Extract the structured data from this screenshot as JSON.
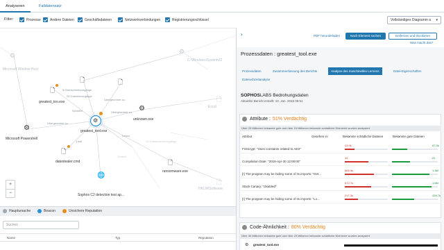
{
  "tabs": [
    "Analyseren",
    "Falldatensatz"
  ],
  "filter": {
    "label": "Filter:",
    "items": [
      "Prozesse",
      "Andere Dateien",
      "Geschäftsdateien",
      "Netzwerkverbindungen",
      "Registrierungsschlüssel"
    ],
    "dropdown": "Vollständiges Diagramm a",
    "dropdown_icon": "chevron-down-icon"
  },
  "graph": {
    "center": "greatest_tool.exe",
    "nodes": {
      "powershell": "Microsoft Powershell",
      "greatest_doc": "greatest_too.exe",
      "unknown": "unknown.exe",
      "datestealer": "datestealer.cmd",
      "ransomware": "ransomware.exe",
      "c2": "Sophos C2 detection test ap...",
      "faded_top_left": "Microsoft Window Host",
      "faded_top_right": "C:\\Windows\\System32",
      "faded_right": "Excel",
      "faded_right2": "HKLM\\Software"
    },
    "edges": {
      "e1": "5 Dateischreibvorgänge",
      "e2": "26 Dateieisvorgänge",
      "e3": "Übergeordnet zu",
      "e4": "Schreibt",
      "e5": "Übergeordnet zu",
      "e6": "Übergeordnet zu",
      "e7": "15 Dateischreibvorgänge",
      "e8": "Lädt",
      "e9": "Lesen",
      "e10": "Erstellt"
    },
    "zoom": [
      "+",
      "−"
    ]
  },
  "legend": [
    {
      "label": "Hauptursache",
      "color": "#a0a8b0"
    },
    {
      "label": "Beacon",
      "color": "#2a8fd8"
    },
    {
      "label": "Unsichere Reputation",
      "color": "#e88c1a"
    }
  ],
  "search": {
    "placeholder": "Suchen"
  },
  "table_headers": [
    "Name",
    "Typ",
    "Reputation"
  ],
  "right": {
    "buttons": {
      "pdf": "PDF herunterladen",
      "next": "Nach Element suchen",
      "remove": "Entfernen und blockieren",
      "what": "Was macht das?"
    },
    "title": "Prozessdaten : greatest_tool.exe",
    "subtabs": [
      "Prozessdaten",
      "Zusammenfassung des Berichts",
      "Analyse des maschinellen Lernens",
      "Datei-Eigenschaften",
      "Dateiuchzeitanalyse"
    ],
    "sophos_brand": "SOPHOS",
    "sophos_rest": "LABS Bedrohungsdaten",
    "report": "Aktueller Bericht erstellt: 10. Jan. 2019 09:51",
    "attr": {
      "title": "Attribute :",
      "verdict": "51% Verdächtig",
      "note": "Über 29 Millionen bekannte gute und über 15 Millionen bekannte schädliche Elemente wurden analysiert",
      "col_attr": "Attribut",
      "col_seen": "Gesehen in:",
      "col_bad": "Bekannte schädliche Dateien",
      "col_good": "Bekannte gute Dateien",
      "rows": [
        {
          "label": "Firstcrypt: \"Uses constants related to AES\"",
          "bad": "43.9k",
          "good": "67.3k",
          "bad_frac": 0.22,
          "good_frac": 0.34
        },
        {
          "label": "Compilation Date: \"2018-Apr-30 12:00:00\"",
          "bad": "34",
          "good": "22",
          "bad_frac": 0.55,
          "good_frac": 0.4
        },
        {
          "label": "[!] The program may be hiding some of its imports: \"Get...",
          "bad": "665.9k",
          "good": "1.3M",
          "bad_frac": 0.68,
          "good_frac": 0.82
        },
        {
          "label": "Stack Canary: \"disabled\"",
          "bad": "672.7k",
          "good": "1.6M",
          "bad_frac": 0.62,
          "good_frac": 0.86
        },
        {
          "label": "[!] The program may be hiding some of its imports: \"Lo...",
          "bad": "217.3k",
          "good": "428.7k",
          "bad_frac": 0.3,
          "good_frac": 0.48
        }
      ]
    },
    "code": {
      "title": "Code-Ähnlichkeit :",
      "verdict": "80% Verdächtig",
      "note": "Über 30 Millionen bekannte gute und über 29 Millionen bekannte schädliche Elemente wurden analysiert",
      "row": "greatest_tool.exe"
    }
  }
}
